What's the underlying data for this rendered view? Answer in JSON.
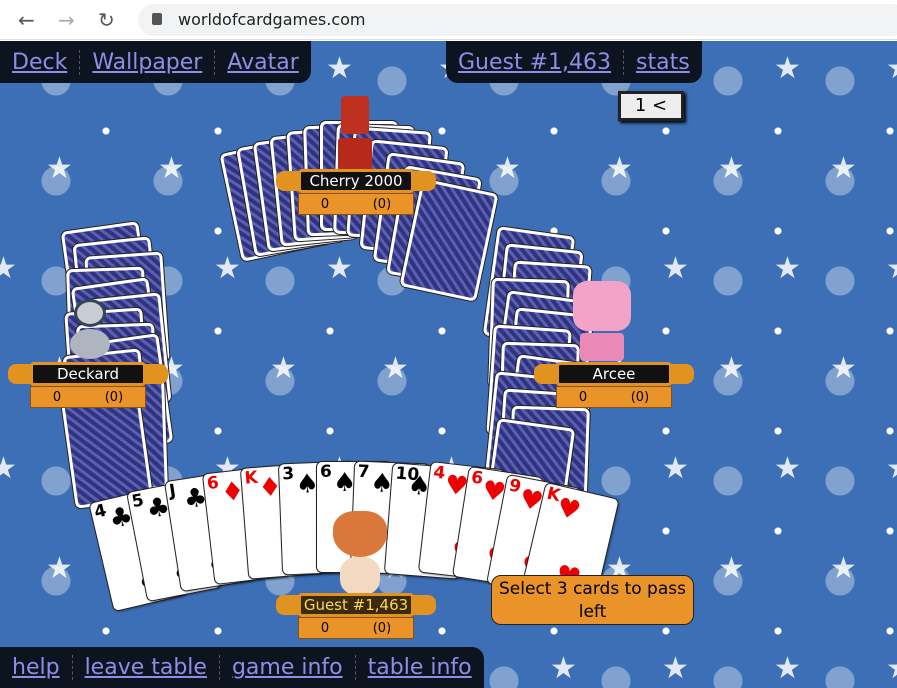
{
  "browser": {
    "url": "worldofcardgames.com",
    "back_icon": "arrow-left",
    "forward_icon": "arrow-right",
    "reload_icon": "reload",
    "lock_icon": "lock"
  },
  "top_left_menu": [
    "Deck",
    "Wallpaper",
    "Avatar"
  ],
  "top_right_menu": [
    "Guest #1,463",
    "stats"
  ],
  "bottom_menu": [
    "help",
    "leave table",
    "game info",
    "table info"
  ],
  "round_indicator": "1 <",
  "players": {
    "top": {
      "name": "Cherry 2000",
      "score": "0",
      "round_score": "(0)"
    },
    "left": {
      "name": "Deckard",
      "score": "0",
      "round_score": "(0)"
    },
    "right": {
      "name": "Arcee",
      "score": "0",
      "round_score": "(0)"
    },
    "me": {
      "name": "Guest #1,463",
      "score": "0",
      "round_score": "(0)"
    }
  },
  "hand": [
    {
      "rank": "4",
      "suit": "♣"
    },
    {
      "rank": "5",
      "suit": "♣"
    },
    {
      "rank": "J",
      "suit": "♣"
    },
    {
      "rank": "6",
      "suit": "♦"
    },
    {
      "rank": "K",
      "suit": "♦"
    },
    {
      "rank": "3",
      "suit": "♠"
    },
    {
      "rank": "6",
      "suit": "♠"
    },
    {
      "rank": "7",
      "suit": "♠"
    },
    {
      "rank": "10",
      "suit": "♠"
    },
    {
      "rank": "4",
      "suit": "♥"
    },
    {
      "rank": "6",
      "suit": "♥"
    },
    {
      "rank": "9",
      "suit": "♥"
    },
    {
      "rank": "K",
      "suit": "♥"
    }
  ],
  "message": "Select 3 cards to pass left",
  "colors": {
    "table": "#3d6fb6",
    "menu_bg": "#0e1320",
    "link": "#8d8fe6",
    "plate": "#e99329"
  }
}
